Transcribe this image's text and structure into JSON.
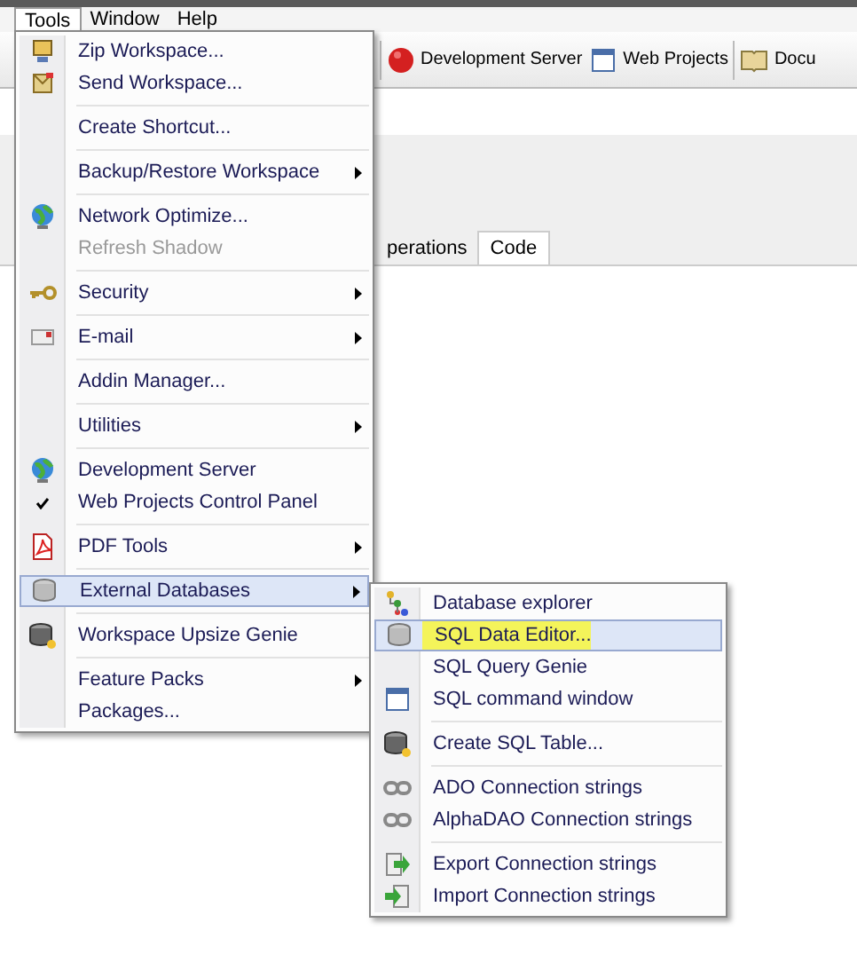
{
  "menubar": [
    {
      "label": "Tools",
      "open": true
    },
    {
      "label": "Window",
      "open": false
    },
    {
      "label": "Help",
      "open": false
    }
  ],
  "toolbar": [
    {
      "label": "Development Server"
    },
    {
      "label": "Web Projects"
    },
    {
      "label": "Docu"
    }
  ],
  "tabs": [
    {
      "label": "perations",
      "selected": false
    },
    {
      "label": "Code",
      "selected": true
    }
  ],
  "menu": {
    "items": [
      {
        "kind": "item",
        "label": "Zip Workspace..."
      },
      {
        "kind": "item",
        "label": "Send Workspace..."
      },
      {
        "kind": "separator"
      },
      {
        "kind": "item",
        "label": "Create Shortcut..."
      },
      {
        "kind": "separator"
      },
      {
        "kind": "item",
        "label": "Backup/Restore Workspace",
        "submenu": true
      },
      {
        "kind": "separator"
      },
      {
        "kind": "item",
        "label": "Network Optimize..."
      },
      {
        "kind": "item",
        "label": "Refresh Shadow",
        "disabled": true
      },
      {
        "kind": "separator"
      },
      {
        "kind": "item",
        "label": "Security",
        "submenu": true
      },
      {
        "kind": "separator"
      },
      {
        "kind": "item",
        "label": "E-mail",
        "submenu": true
      },
      {
        "kind": "separator"
      },
      {
        "kind": "item",
        "label": "Addin Manager..."
      },
      {
        "kind": "separator"
      },
      {
        "kind": "item",
        "label": "Utilities",
        "submenu": true
      },
      {
        "kind": "separator"
      },
      {
        "kind": "item",
        "label": "Development Server"
      },
      {
        "kind": "item",
        "label": "Web Projects Control Panel",
        "checked": true
      },
      {
        "kind": "separator"
      },
      {
        "kind": "item",
        "label": "PDF Tools",
        "submenu": true
      },
      {
        "kind": "separator"
      },
      {
        "kind": "item",
        "label": "External Databases",
        "submenu": true,
        "selected": true
      },
      {
        "kind": "separator"
      },
      {
        "kind": "item",
        "label": "Workspace Upsize Genie"
      },
      {
        "kind": "separator"
      },
      {
        "kind": "item",
        "label": "Feature Packs",
        "submenu": true
      },
      {
        "kind": "item",
        "label": "Packages..."
      }
    ]
  },
  "submenu": {
    "items": [
      {
        "kind": "item",
        "label": "Database explorer"
      },
      {
        "kind": "item",
        "label": "SQL Data Editor...",
        "selected": true,
        "highlighted": true
      },
      {
        "kind": "item",
        "label": "SQL Query Genie"
      },
      {
        "kind": "item",
        "label": "SQL command window"
      },
      {
        "kind": "separator"
      },
      {
        "kind": "item",
        "label": "Create SQL Table..."
      },
      {
        "kind": "separator"
      },
      {
        "kind": "item",
        "label": "ADO Connection strings"
      },
      {
        "kind": "item",
        "label": "AlphaDAO Connection strings"
      },
      {
        "kind": "separator"
      },
      {
        "kind": "item",
        "label": "Export Connection strings"
      },
      {
        "kind": "item",
        "label": "Import Connection strings"
      }
    ]
  }
}
